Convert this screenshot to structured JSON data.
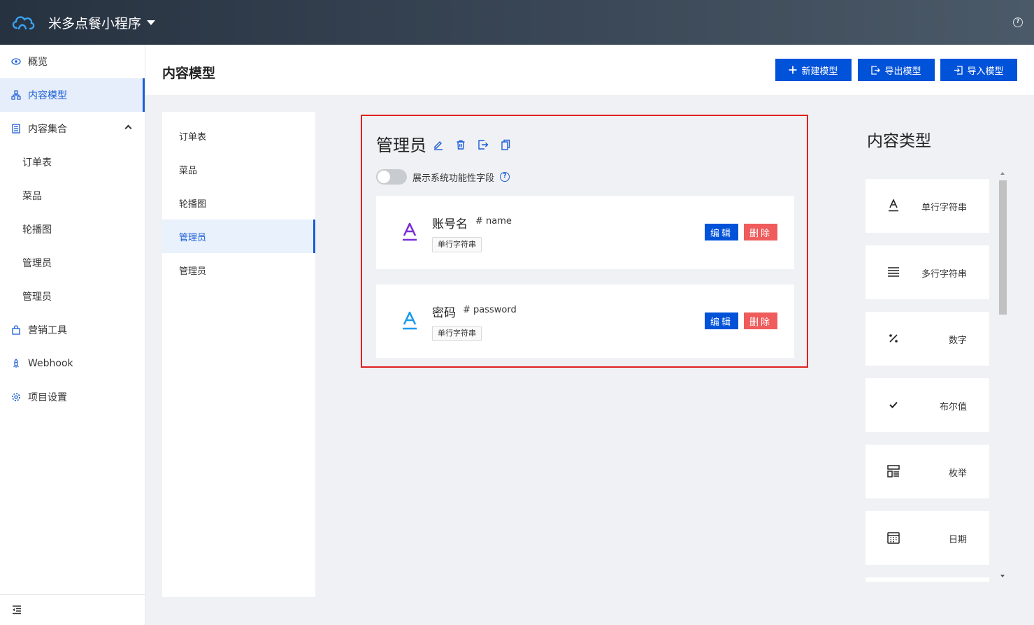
{
  "app": {
    "title": "米多点餐小程序",
    "accent": "#0052d9"
  },
  "sidebar": {
    "items": [
      {
        "label": "概览",
        "icon": "eye-icon"
      },
      {
        "label": "内容模型",
        "icon": "model-icon",
        "active": true
      },
      {
        "label": "内容集合",
        "icon": "collection-icon",
        "expanded": true
      },
      {
        "label": "订单表"
      },
      {
        "label": "菜品"
      },
      {
        "label": "轮播图"
      },
      {
        "label": "管理员"
      },
      {
        "label": "管理员"
      },
      {
        "label": "营销工具",
        "icon": "bag-icon"
      },
      {
        "label": "Webhook",
        "icon": "rocket-icon"
      },
      {
        "label": "项目设置",
        "icon": "gear-icon"
      }
    ]
  },
  "header": {
    "title": "内容模型",
    "new_model": "新建模型",
    "export_model": "导出模型",
    "import_model": "导入模型"
  },
  "models": {
    "items": [
      {
        "label": "订单表"
      },
      {
        "label": "菜品"
      },
      {
        "label": "轮播图"
      },
      {
        "label": "管理员",
        "active": true
      },
      {
        "label": "管理员"
      }
    ]
  },
  "detail": {
    "name": "管理员",
    "toggle_label": "展示系统功能性字段",
    "fields": [
      {
        "name": "账号名",
        "key": "# name",
        "type": "单行字符串",
        "edit": "编辑",
        "delete": "删除",
        "icon_color": "#7b2fd6"
      },
      {
        "name": "密码",
        "key": "# password",
        "type": "单行字符串",
        "edit": "编辑",
        "delete": "删除",
        "icon_color": "#1a9bf0"
      }
    ]
  },
  "types": {
    "title": "内容类型",
    "items": [
      {
        "label": "单行字符串",
        "icon": "single-line-icon"
      },
      {
        "label": "多行字符串",
        "icon": "multi-line-icon"
      },
      {
        "label": "数字",
        "icon": "percent-icon"
      },
      {
        "label": "布尔值",
        "icon": "check-icon"
      },
      {
        "label": "枚举",
        "icon": "enum-icon"
      },
      {
        "label": "日期",
        "icon": "calendar-icon"
      }
    ]
  }
}
